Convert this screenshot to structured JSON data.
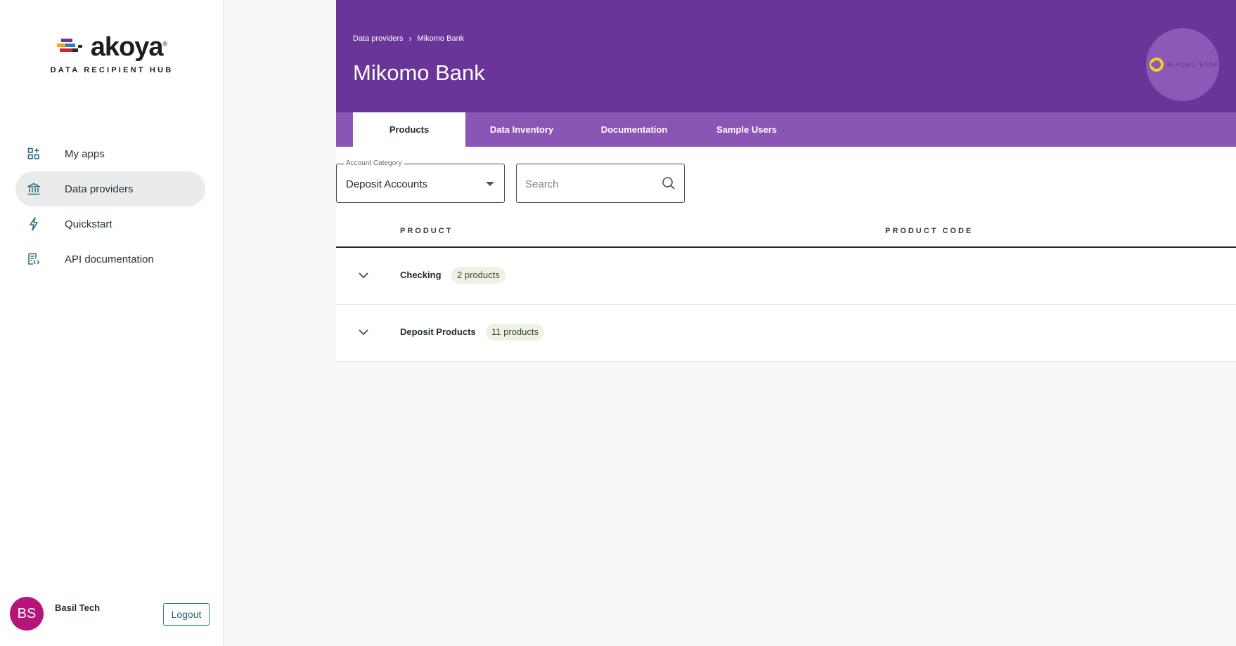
{
  "brand": {
    "logo_word": "akoya",
    "logo_reg": "®",
    "subtitle": "DATA RECIPIENT HUB"
  },
  "sidebar": {
    "items": [
      {
        "label": "My apps",
        "icon": "apps-add-icon",
        "active": false
      },
      {
        "label": "Data providers",
        "icon": "bank-icon",
        "active": true
      },
      {
        "label": "Quickstart",
        "icon": "lightning-icon",
        "active": false
      },
      {
        "label": "API documentation",
        "icon": "api-doc-icon",
        "active": false
      }
    ]
  },
  "user": {
    "initials": "BS",
    "name": "Basil Tech",
    "logout_label": "Logout",
    "avatar_color": "#b5157a"
  },
  "header": {
    "breadcrumb": [
      "Data providers",
      "Mikomo Bank"
    ],
    "breadcrumb_separator": "›",
    "title": "Mikomo Bank",
    "bank_logo_text": "MIKOMO BANK",
    "color": "#6a3599"
  },
  "tabs": [
    {
      "label": "Products",
      "active": true
    },
    {
      "label": "Data Inventory",
      "active": false
    },
    {
      "label": "Documentation",
      "active": false
    },
    {
      "label": "Sample Users",
      "active": false
    }
  ],
  "filters": {
    "category_label": "Account Category",
    "category_value": "Deposit Accounts",
    "search_placeholder": "Search"
  },
  "table": {
    "columns": [
      "PRODUCT",
      "PRODUCT CODE"
    ],
    "rows": [
      {
        "name": "Checking",
        "badge": "2 products"
      },
      {
        "name": "Deposit Products",
        "badge": "11 products"
      }
    ]
  }
}
